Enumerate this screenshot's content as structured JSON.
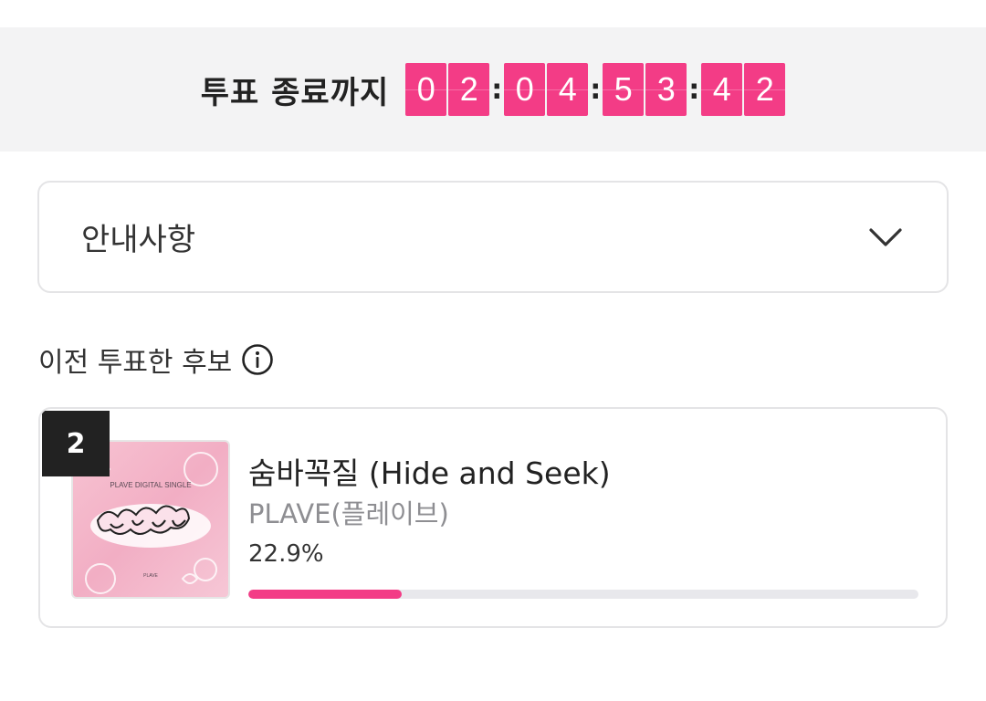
{
  "countdown": {
    "label": "투표 종료까지",
    "days": [
      "0",
      "2"
    ],
    "hours": [
      "0",
      "4"
    ],
    "minutes": [
      "5",
      "3"
    ],
    "seconds": [
      "4",
      "2"
    ],
    "separator": ":"
  },
  "notice": {
    "label": "안내사항",
    "icon": "chevron-down-icon"
  },
  "previous_vote": {
    "heading": "이전 투표한 후보",
    "icon": "info-icon"
  },
  "candidate": {
    "rank": "2",
    "title": "숨바꼭질 (Hide and Seek)",
    "artist": "PLAVE(플레이브)",
    "percent_label": "22.9%",
    "percent_value": 22.9,
    "album_text": "PLAVE DIGITAL SINGLE"
  },
  "colors": {
    "accent": "#f33c86",
    "badge": "#222222",
    "track": "#e8e8ec"
  }
}
